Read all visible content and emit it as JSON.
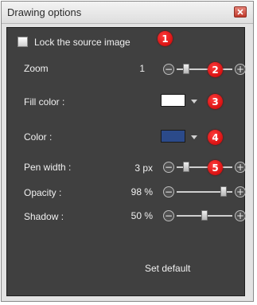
{
  "window": {
    "title": "Drawing options"
  },
  "lock_source": {
    "label": "Lock the source image",
    "checked": false
  },
  "zoom": {
    "label": "Zoom",
    "value": "1"
  },
  "fill_color": {
    "label": "Fill color :",
    "color": "#ffffff"
  },
  "color": {
    "label": "Color :",
    "color": "#2b4a8a"
  },
  "pen_width": {
    "label": "Pen width :",
    "value": "3 px"
  },
  "opacity": {
    "label": "Opacity :",
    "value": "98 %"
  },
  "shadow": {
    "label": "Shadow :",
    "value": "50 %"
  },
  "buttons": {
    "minus": "−",
    "plus": "+"
  },
  "set_default": {
    "label": "Set default"
  },
  "badges": [
    "1",
    "2",
    "3",
    "4",
    "5"
  ]
}
